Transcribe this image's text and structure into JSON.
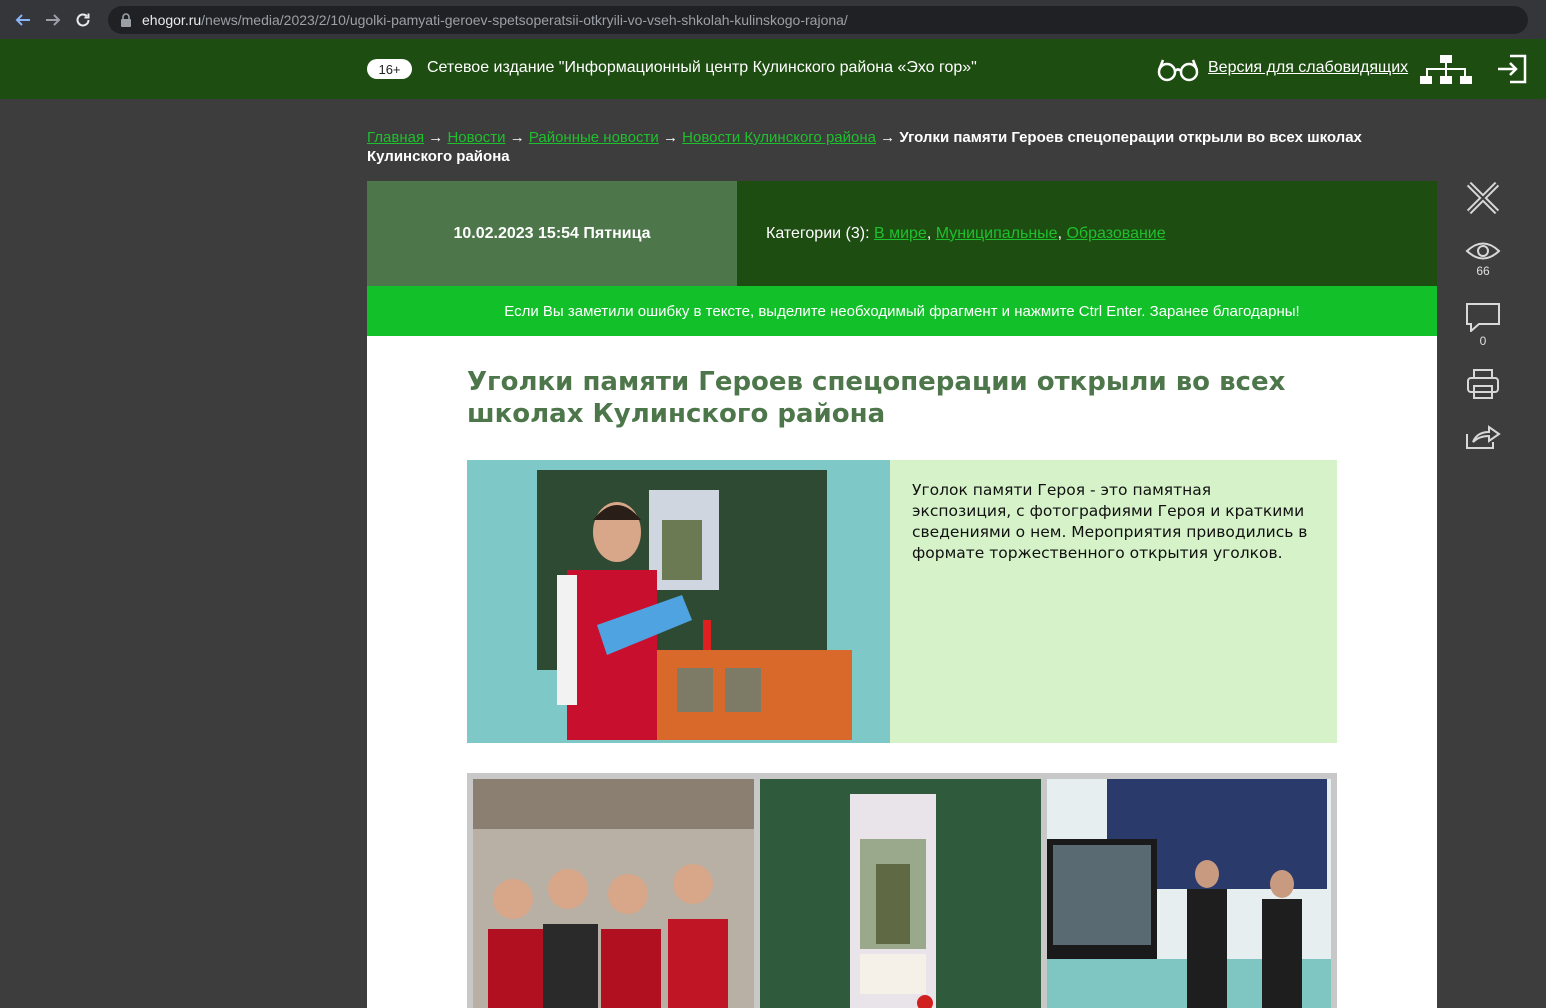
{
  "browser": {
    "url_host": "ehogor.ru",
    "url_path": "/news/media/2023/2/10/ugolki-pamyati-geroev-spetsoperatsii-otkryili-vo-vseh-shkolah-kulinskogo-rajona/"
  },
  "header": {
    "age_rating": "16+",
    "site_title": "Сетевое издание \"Информационный центр Кулинского района «Эхо гор»\"",
    "vision_link": "Версия для слабовидящих"
  },
  "breadcrumb": {
    "items": [
      "Главная",
      "Новости",
      "Районные новости",
      "Новости Кулинского района"
    ],
    "separator": "→",
    "current": "Уголки памяти Героев спецоперации открыли во всех школах Кулинского района"
  },
  "meta": {
    "date": "10.02.2023 15:54 Пятница",
    "categories_label": "Категории (3):",
    "categories": [
      "В мире",
      "Муниципальные",
      "Образование"
    ]
  },
  "notice": "Если Вы заметили ошибку в тексте, выделите необходимый фрагмент и нажмите Ctrl Enter. Заранее благодарны!",
  "article": {
    "title": "Уголки памяти Героев спецоперации открыли во всех школах Кулинского района",
    "lead": "Уголок памяти Героя - это памятная экспозиция, с фотографиями Героя и краткими сведениями о нем. Мероприятия приводились в формате торжественного открытия уголков."
  },
  "tools": {
    "views": "66",
    "comments": "0"
  },
  "colors": {
    "header_green": "#1e4d12",
    "date_green": "#4d774a",
    "notice_green": "#12c12a",
    "link_green": "#1ec02d",
    "lead_bg": "#d5f2c9"
  }
}
